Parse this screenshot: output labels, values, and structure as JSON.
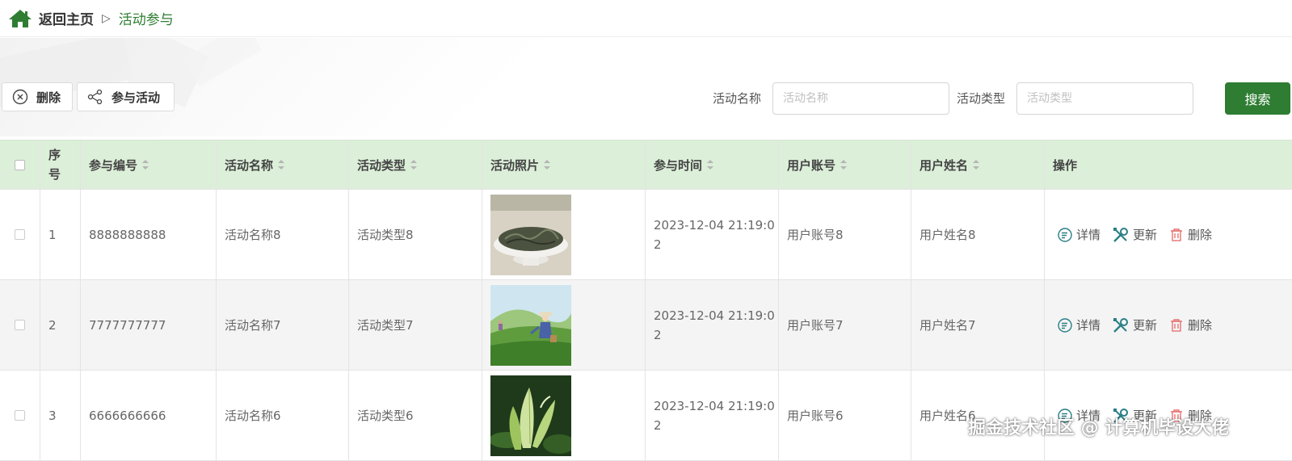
{
  "breadcrumb": {
    "home": "返回主页",
    "separator": "▷",
    "current": "活动参与"
  },
  "toolbar": {
    "delete_label": "删除",
    "join_label": "参与活动",
    "search_name_label": "活动名称",
    "search_name_placeholder": "活动名称",
    "search_type_label": "活动类型",
    "search_type_placeholder": "活动类型",
    "search_button": "搜索"
  },
  "table": {
    "headers": {
      "index": "序号",
      "number": "参与编号",
      "name": "活动名称",
      "type": "活动类型",
      "photo": "活动照片",
      "time": "参与时间",
      "account": "用户账号",
      "user_name": "用户姓名",
      "ops": "操作"
    },
    "rows": [
      {
        "index": "1",
        "number": "8888888888",
        "name": "活动名称8",
        "type": "活动类型8",
        "photo": "tea-leaves-bowl",
        "time": "2023-12-04 21:19:02",
        "account": "用户账号8",
        "user_name": "用户姓名8"
      },
      {
        "index": "2",
        "number": "7777777777",
        "name": "活动名称7",
        "type": "活动类型7",
        "photo": "tea-picking-field",
        "time": "2023-12-04 21:19:02",
        "account": "用户账号7",
        "user_name": "用户姓名7"
      },
      {
        "index": "3",
        "number": "6666666666",
        "name": "活动名称6",
        "type": "活动类型6",
        "photo": "tea-buds-closeup",
        "time": "2023-12-04 21:19:02",
        "account": "用户账号6",
        "user_name": "用户姓名6"
      }
    ],
    "ops": {
      "detail": "详情",
      "update": "更新",
      "delete": "删除"
    }
  },
  "watermark": "掘金技术社区 @ 计算机毕设大佬",
  "colors": {
    "primary": "#2e7d32",
    "header_bg": "#dcefd9",
    "delete_red": "#e57373",
    "op_teal": "#2a7f86"
  }
}
